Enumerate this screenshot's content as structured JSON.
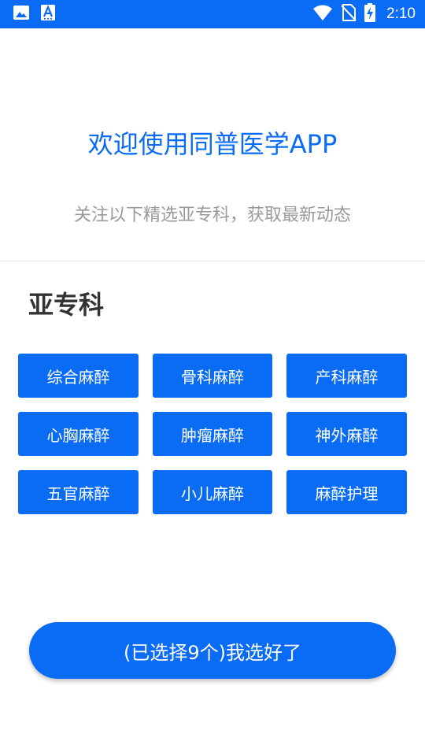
{
  "status_bar": {
    "time": "2:10",
    "background_color": "#0a6cf5",
    "icons": [
      "image-icon",
      "text-a-icon",
      "wifi-icon",
      "no-sim-icon",
      "battery-charging-icon"
    ]
  },
  "header": {
    "title": "欢迎使用同普医学APP",
    "subtitle": "关注以下精选亚专科，获取最新动态"
  },
  "section": {
    "title": "亚专科",
    "items": [
      {
        "label": "综合麻醉"
      },
      {
        "label": "骨科麻醉"
      },
      {
        "label": "产科麻醉"
      },
      {
        "label": "心胸麻醉"
      },
      {
        "label": "肿瘤麻醉"
      },
      {
        "label": "神外麻醉"
      },
      {
        "label": "五官麻醉"
      },
      {
        "label": "小儿麻醉"
      },
      {
        "label": "麻醉护理"
      }
    ]
  },
  "confirm": {
    "label": "(已选择9个)我选好了"
  },
  "colors": {
    "accent": "#0a6cf5",
    "subtitle": "#9a9a9a",
    "section_title": "#333333"
  }
}
